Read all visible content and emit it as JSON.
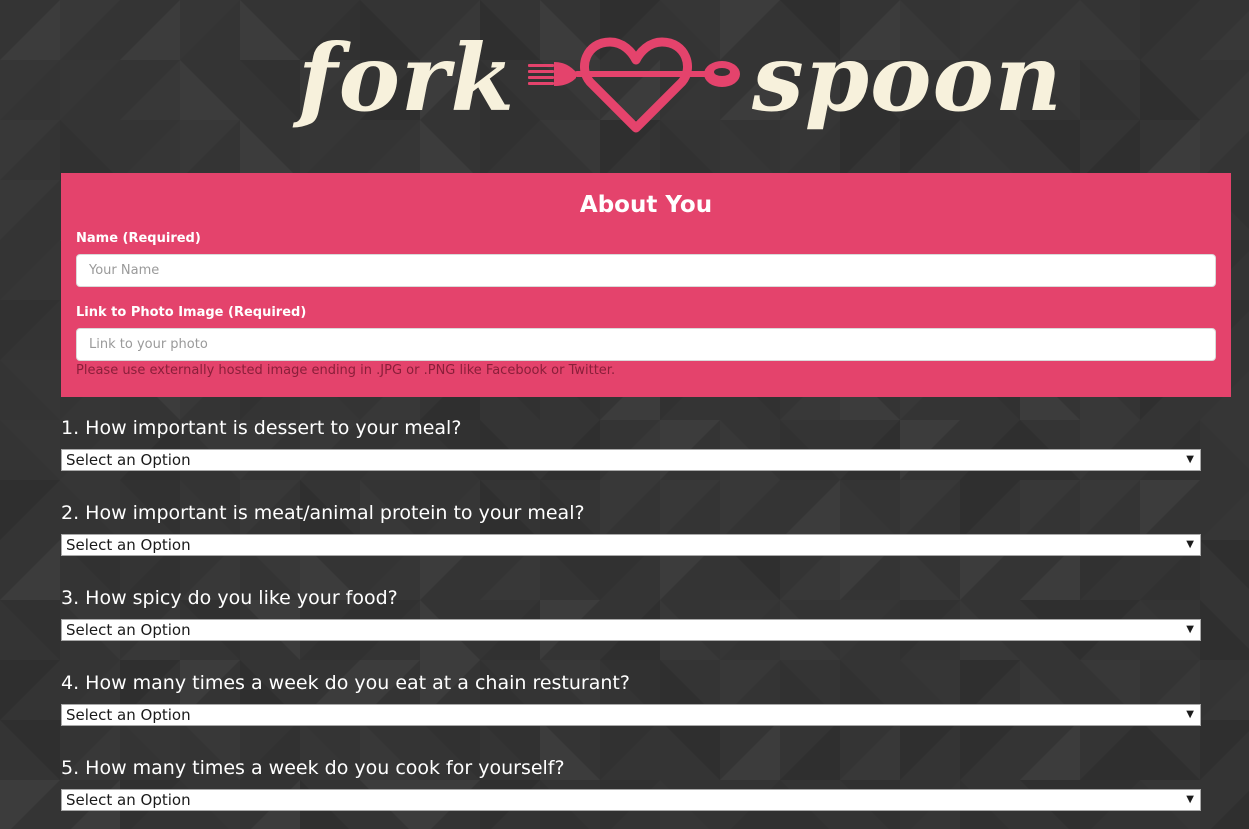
{
  "brand": {
    "word_left": "fork",
    "word_right": "spoon",
    "text_color": "#f7f1dc",
    "accent_color": "#e4436c",
    "emblem_icon": "heart-fork-spoon-icon"
  },
  "about": {
    "title": "About You",
    "name_label": "Name (Required)",
    "name_placeholder": "Your Name",
    "name_value": "",
    "photo_label": "Link to Photo Image (Required)",
    "photo_placeholder": "Link to your photo",
    "photo_value": "",
    "photo_help": "Please use externally hosted image ending in .JPG or .PNG like Facebook or Twitter."
  },
  "questions": [
    {
      "label": "1. How important is dessert to your meal?",
      "selected": "Select an Option"
    },
    {
      "label": "2. How important is meat/animal protein to your meal?",
      "selected": "Select an Option"
    },
    {
      "label": "3. How spicy do you like your food?",
      "selected": "Select an Option"
    },
    {
      "label": "4. How many times a week do you eat at a chain resturant?",
      "selected": "Select an Option"
    },
    {
      "label": "5. How many times a week do you cook for yourself?",
      "selected": "Select an Option"
    }
  ],
  "colors": {
    "background": "#343434",
    "panel": "#e4436c",
    "help_text": "#8a1f3a"
  }
}
